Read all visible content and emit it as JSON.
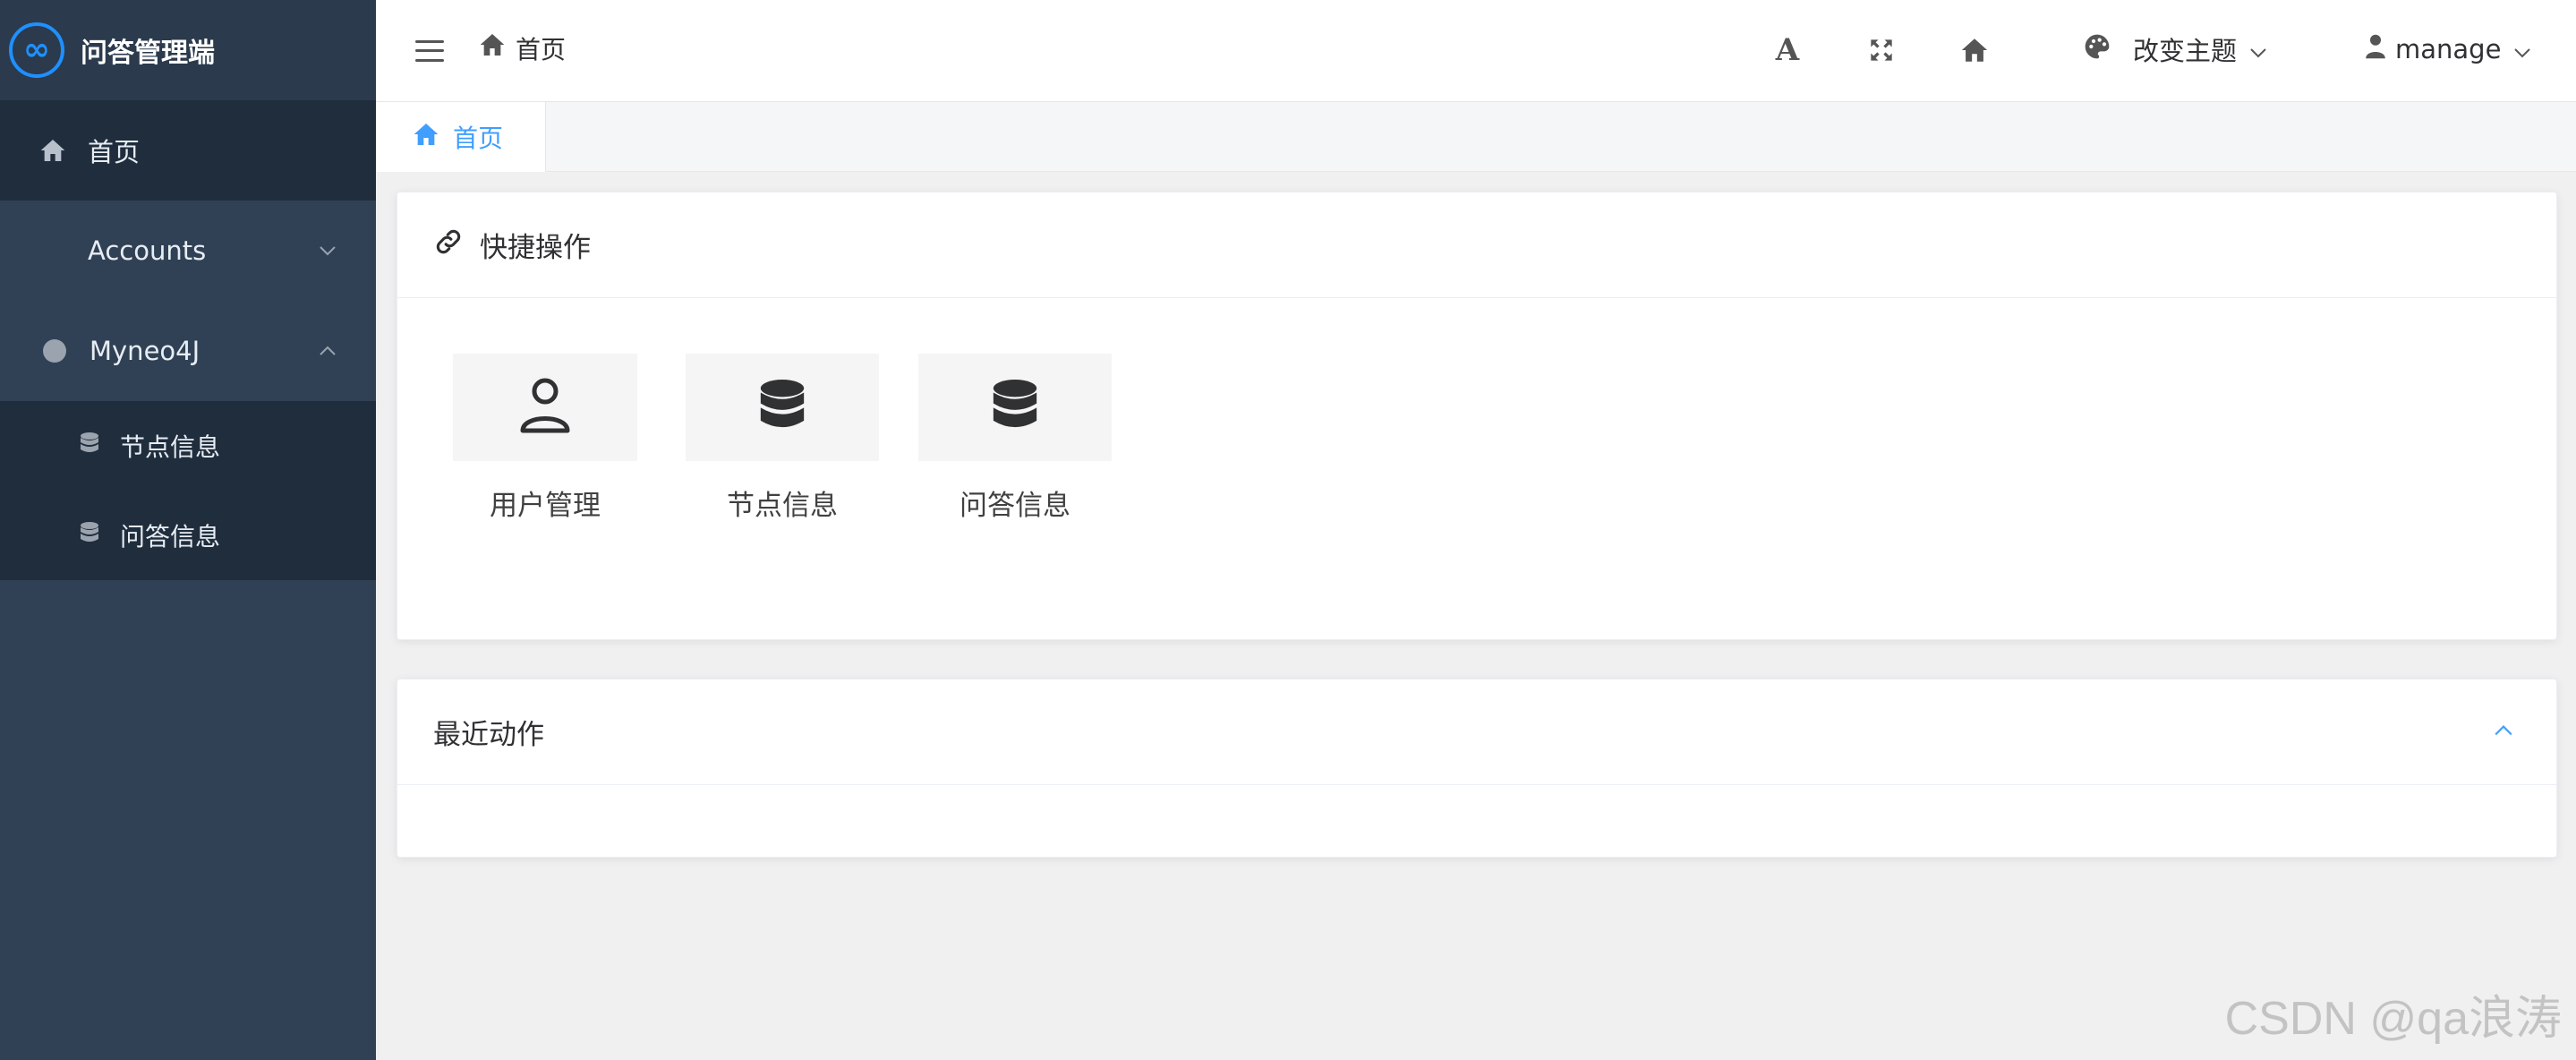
{
  "app": {
    "title": "问答管理端"
  },
  "sidebar": {
    "items": [
      {
        "label": "首页",
        "icon": "home-icon"
      },
      {
        "label": "Accounts",
        "icon": "chevron-down-icon"
      },
      {
        "label": "Myneo4J",
        "icon": "circle-icon",
        "expanded": true,
        "children": [
          {
            "label": "节点信息",
            "icon": "database-icon"
          },
          {
            "label": "问答信息",
            "icon": "database-icon"
          }
        ]
      }
    ],
    "colors": {
      "bg": "#304156",
      "active": "#1f2d3d"
    }
  },
  "header": {
    "breadcrumb": "首页",
    "font_button": "A",
    "theme_label": "改变主题",
    "user_label": "manage"
  },
  "tags": {
    "active": "首页",
    "active_color": "#409eff"
  },
  "quick": {
    "title": "快捷操作",
    "shortcuts": [
      {
        "label": "用户管理",
        "icon": "user-icon"
      },
      {
        "label": "节点信息",
        "icon": "database-icon"
      },
      {
        "label": "问答信息",
        "icon": "database-icon"
      }
    ]
  },
  "recent": {
    "title": "最近动作"
  },
  "watermark": "CSDN @qa浪涛"
}
